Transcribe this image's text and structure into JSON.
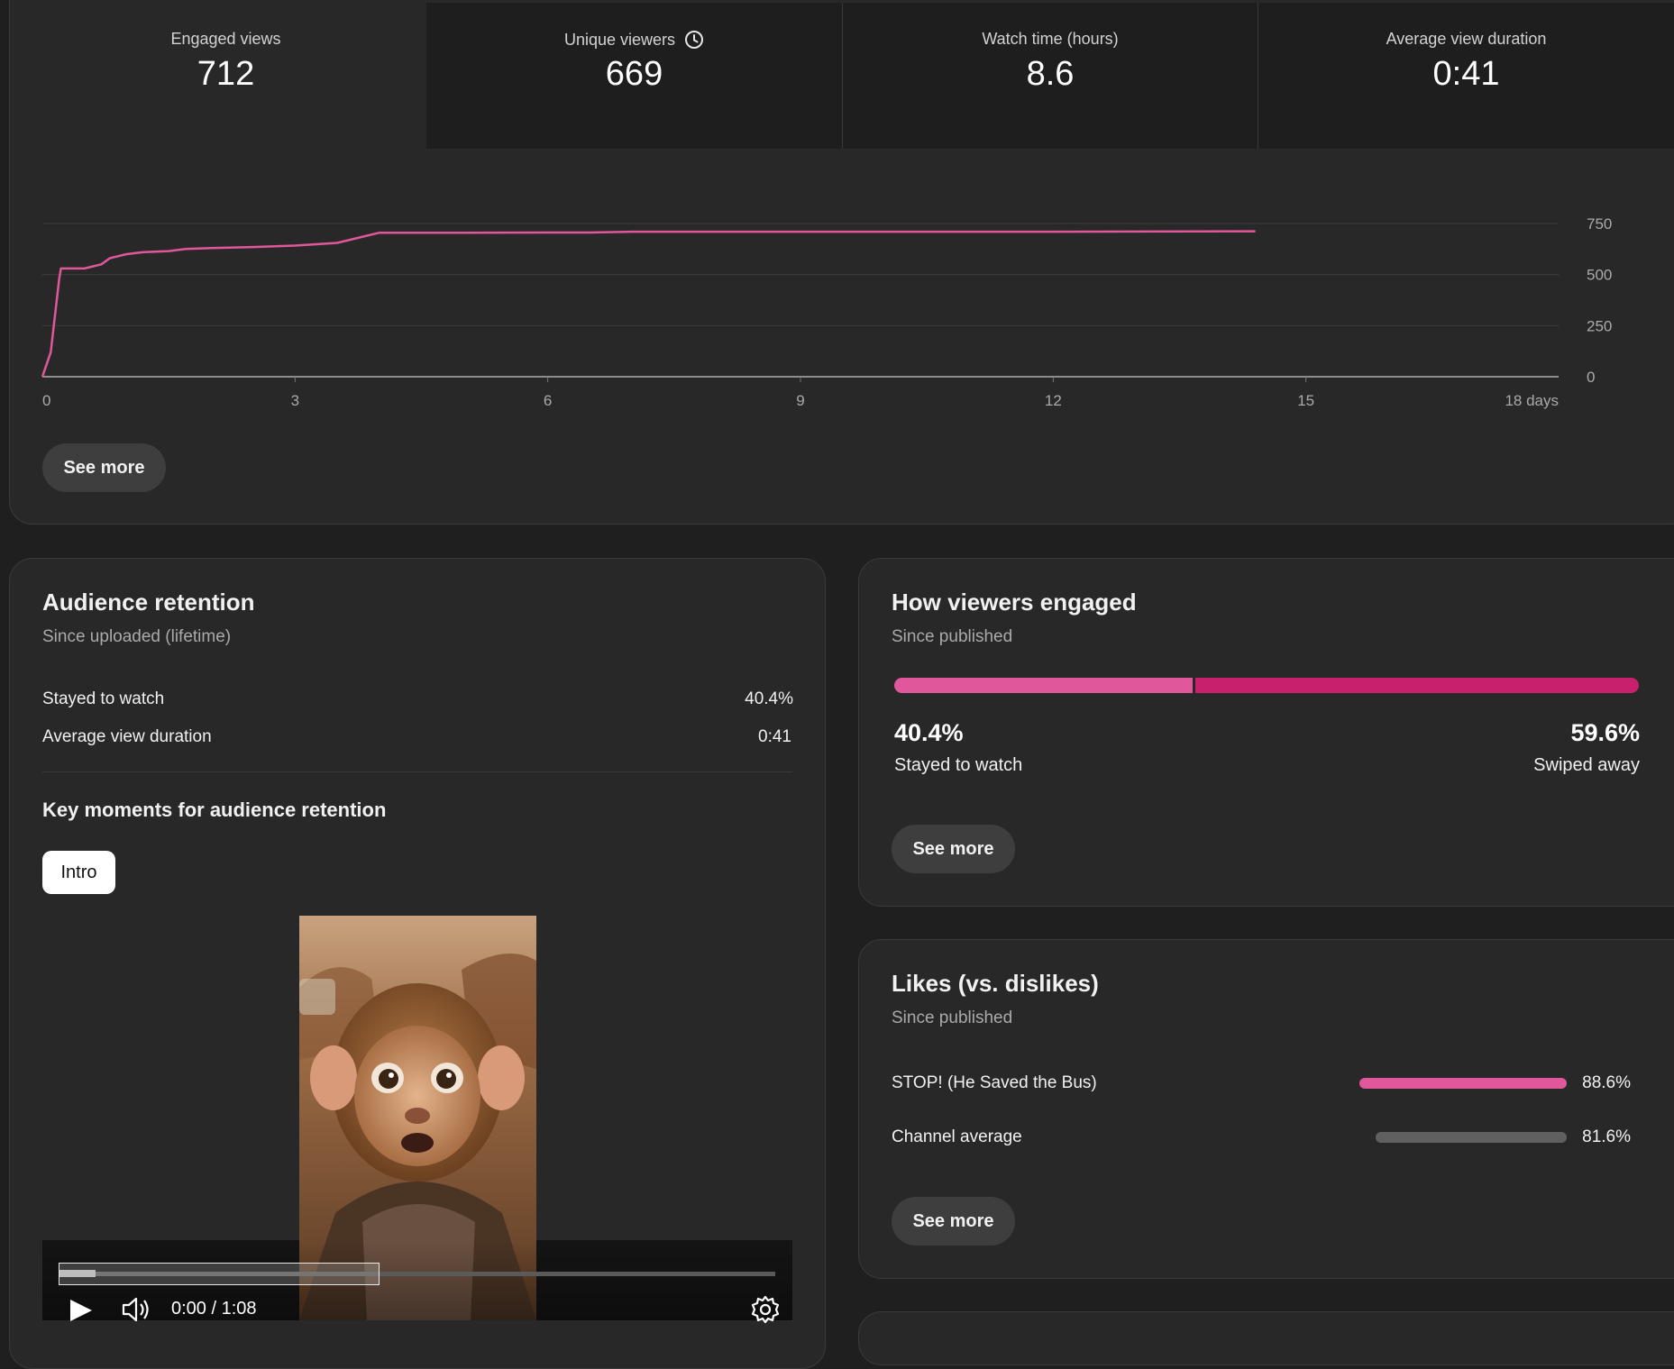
{
  "metrics": [
    {
      "label": "Engaged views",
      "value": "712",
      "active": true
    },
    {
      "label": "Unique viewers",
      "value": "669",
      "active": false,
      "icon": "clock-icon"
    },
    {
      "label": "Watch time (hours)",
      "value": "8.6",
      "active": false
    },
    {
      "label": "Average view duration",
      "value": "0:41",
      "active": false
    }
  ],
  "chart_data": {
    "type": "line",
    "series": [
      {
        "color": "#e0589b",
        "x": [
          0,
          0.1,
          0.2,
          0.22,
          0.5,
          0.7,
          0.8,
          1.0,
          1.2,
          1.5,
          1.7,
          2.0,
          2.5,
          3.0,
          3.5,
          3.7,
          4.0,
          5.0,
          6.0,
          6.5,
          7.0,
          9.0,
          12.0,
          14.4
        ],
        "y": [
          0,
          120,
          480,
          530,
          530,
          550,
          580,
          600,
          610,
          615,
          625,
          630,
          635,
          642,
          655,
          675,
          705,
          705,
          706,
          706,
          710,
          710,
          710,
          712
        ]
      }
    ],
    "xlim": [
      0,
      18
    ],
    "ylim": [
      0,
      750
    ],
    "x_ticks": [
      "0",
      "3",
      "6",
      "9",
      "12",
      "15",
      "18 days"
    ],
    "y_ticks": [
      "0",
      "250",
      "500",
      "750"
    ],
    "grid": true
  },
  "overview": {
    "see_more": "See more"
  },
  "retention": {
    "title": "Audience retention",
    "subtitle": "Since uploaded (lifetime)",
    "stayed_label": "Stayed to watch",
    "stayed_value": "40.4%",
    "avd_label": "Average view duration",
    "avd_value": "0:41",
    "key_moments_title": "Key moments for audience retention",
    "chip_label": "Intro",
    "player": {
      "time": "0:00 / 1:08",
      "progress": 0.0
    }
  },
  "engaged": {
    "title": "How viewers engaged",
    "subtitle": "Since published",
    "stayed_pct": "40.4%",
    "stayed_label": "Stayed to watch",
    "stayed_fraction": 0.404,
    "swiped_pct": "59.6%",
    "swiped_label": "Swiped away",
    "colors": {
      "stayed": "#e0589b",
      "swiped": "#c8206c"
    },
    "see_more": "See more"
  },
  "likes": {
    "title": "Likes (vs. dislikes)",
    "subtitle": "Since published",
    "rows": [
      {
        "label": "STOP! (He Saved the Bus)",
        "value": "88.6%",
        "fraction": 0.886,
        "color": "#e0589b"
      },
      {
        "label": "Channel average",
        "value": "81.6%",
        "fraction": 0.816,
        "color": "#606060"
      }
    ],
    "see_more": "See more"
  }
}
